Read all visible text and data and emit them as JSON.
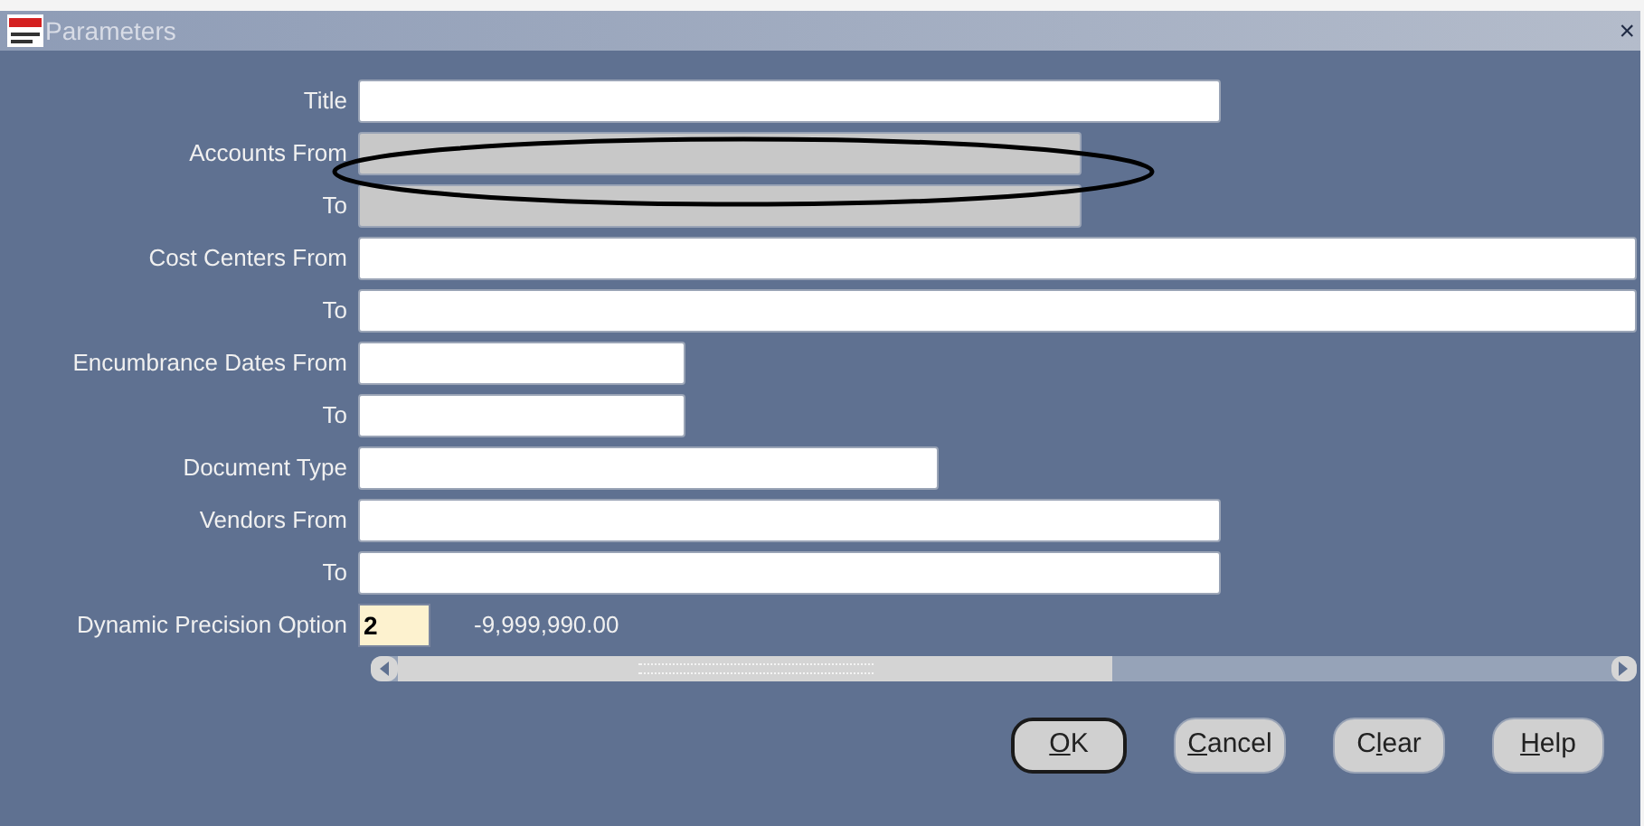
{
  "window": {
    "title": "Parameters",
    "close": "×"
  },
  "fields": [
    {
      "label": "Title",
      "disabled": false
    },
    {
      "label": "Accounts From",
      "disabled": true
    },
    {
      "label": "To",
      "disabled": true
    },
    {
      "label": "Cost Centers From",
      "disabled": false
    },
    {
      "label": "To",
      "disabled": false
    },
    {
      "label": "Encumbrance Dates From",
      "disabled": false
    },
    {
      "label": "To",
      "disabled": false
    },
    {
      "label": "Document Type",
      "disabled": false
    },
    {
      "label": "Vendors From",
      "disabled": false
    },
    {
      "label": "To",
      "disabled": false
    }
  ],
  "precision": {
    "label": "Dynamic Precision Option",
    "value": "2",
    "sample": "-9,999,990.00"
  },
  "buttons": [
    {
      "key": "O",
      "rest": "K",
      "default": true
    },
    {
      "key": "C",
      "rest": "ancel",
      "default": false
    },
    {
      "lead": "C",
      "key": "l",
      "rest": "ear",
      "default": false
    },
    {
      "key": "H",
      "rest": "elp",
      "default": false
    }
  ]
}
